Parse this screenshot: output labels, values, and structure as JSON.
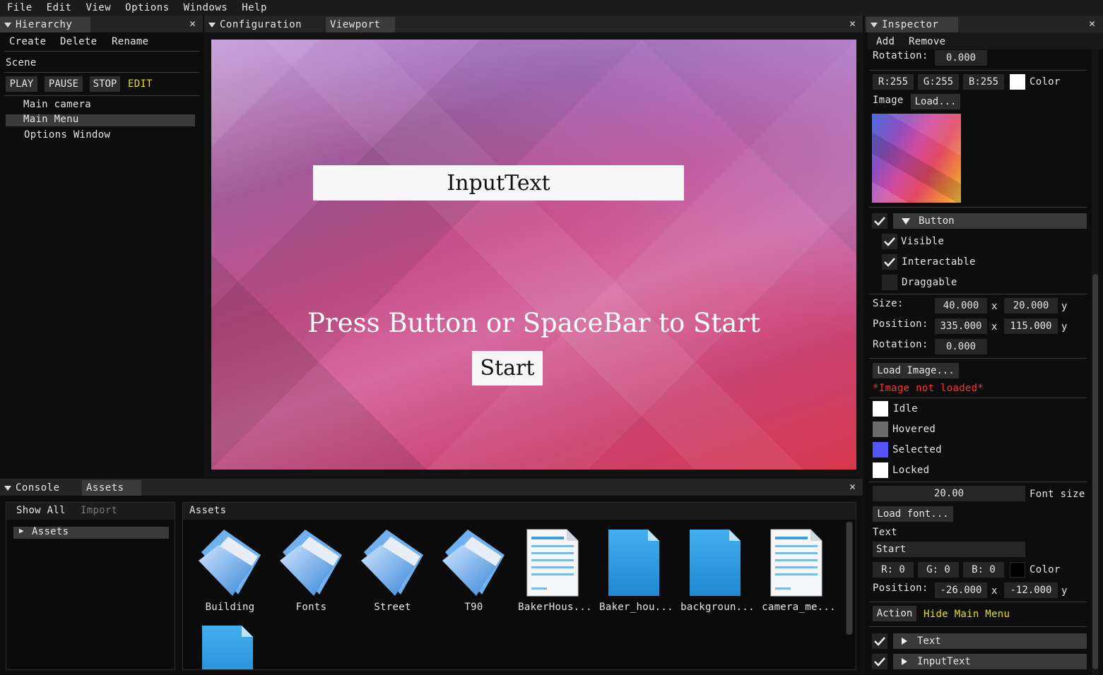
{
  "menu": [
    "File",
    "Edit",
    "View",
    "Options",
    "Windows",
    "Help"
  ],
  "hierarchy": {
    "tab": "Hierarchy",
    "actions": [
      "Create",
      "Delete",
      "Rename"
    ],
    "scene_label": "Scene",
    "controls": [
      "PLAY",
      "PAUSE",
      "STOP"
    ],
    "mode": "EDIT",
    "items": [
      "Main camera",
      "Main Menu",
      "Options Window"
    ],
    "selected_index": 1
  },
  "center": {
    "tabs": [
      "Configuration",
      "Viewport"
    ],
    "active_tab": "Viewport",
    "game": {
      "input_text": "InputText",
      "prompt": "Press Button or SpaceBar to Start",
      "start_button": "Start"
    }
  },
  "bottom": {
    "tabs": [
      "Console",
      "Assets"
    ],
    "active_tab": "Assets",
    "filters": [
      "Show All",
      "Import"
    ],
    "tree": [
      "Assets"
    ],
    "assets_title": "Assets",
    "items": [
      {
        "name": "Building",
        "type": "folder-icon"
      },
      {
        "name": "Fonts",
        "type": "folder-icon"
      },
      {
        "name": "Street",
        "type": "folder-icon"
      },
      {
        "name": "T90",
        "type": "folder-icon"
      },
      {
        "name": "BakerHous...",
        "type": "document-icon"
      },
      {
        "name": "Baker_hou...",
        "type": "file-icon"
      },
      {
        "name": "backgroun...",
        "type": "file-icon"
      },
      {
        "name": "camera_me...",
        "type": "document-icon"
      },
      {
        "name": "",
        "type": "file-icon"
      }
    ]
  },
  "inspector": {
    "tab": "Inspector",
    "actions": [
      "Add",
      "Remove"
    ],
    "top_rotation_label": "Rotation:",
    "top_rotation": "0.000",
    "rgb": [
      "R:255",
      "G:255",
      "B:255"
    ],
    "color_label": "Color",
    "image_label": "Image",
    "load_btn": "Load...",
    "button": {
      "header": "Button",
      "visible": "Visible",
      "interactable": "Interactable",
      "draggable": "Draggable",
      "size_label": "Size:",
      "size": [
        "40.000",
        "20.000"
      ],
      "position_label": "Position:",
      "position": [
        "335.000",
        "115.000"
      ],
      "rotation_label": "Rotation:",
      "rotation": "0.000",
      "x_sep": "x",
      "y_sep": "y",
      "load_image": "Load Image...",
      "image_error": "*Image not loaded*",
      "states": [
        {
          "label": "Idle",
          "color": "#ffffff"
        },
        {
          "label": "Hovered",
          "color": "#6b6b6b"
        },
        {
          "label": "Selected",
          "color": "#5555ff"
        },
        {
          "label": "Locked",
          "color": "#ffffff"
        }
      ],
      "font_size": "20.00",
      "font_size_label": "Font size",
      "load_font": "Load font...",
      "text_label": "Text",
      "text_value": "Start",
      "text_rgb": [
        "R:  0",
        "G:  0",
        "B:  0"
      ],
      "text_color_label": "Color",
      "text_position_label": "Position:",
      "text_position": [
        "-26.000",
        "-12.000"
      ],
      "action_label": "Action",
      "action_value": "Hide Main Menu"
    },
    "children": [
      "Text",
      "InputText"
    ]
  }
}
